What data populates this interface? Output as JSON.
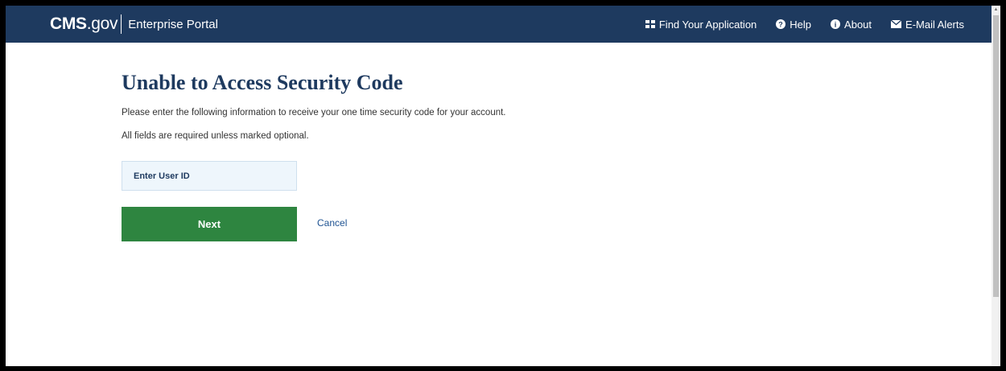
{
  "header": {
    "logo_cms": "CMS",
    "logo_gov": ".gov",
    "portal_name": "Enterprise Portal",
    "nav": [
      {
        "label": "Find Your Application",
        "icon": "grid-icon"
      },
      {
        "label": "Help",
        "icon": "question-circle-icon"
      },
      {
        "label": "About",
        "icon": "info-circle-icon"
      },
      {
        "label": "E-Mail Alerts",
        "icon": "envelope-icon"
      }
    ],
    "colors": {
      "header_bg": "#1e3a5f"
    }
  },
  "main": {
    "title": "Unable to Access Security Code",
    "instruction": "Please enter the following information to receive your one time security code for your account.",
    "required_note": "All fields are required unless marked optional.",
    "user_id_placeholder": "Enter User ID",
    "next_label": "Next",
    "cancel_label": "Cancel",
    "colors": {
      "title": "#1e3a5f",
      "next_button": "#2e8540",
      "cancel_link": "#205493"
    }
  }
}
